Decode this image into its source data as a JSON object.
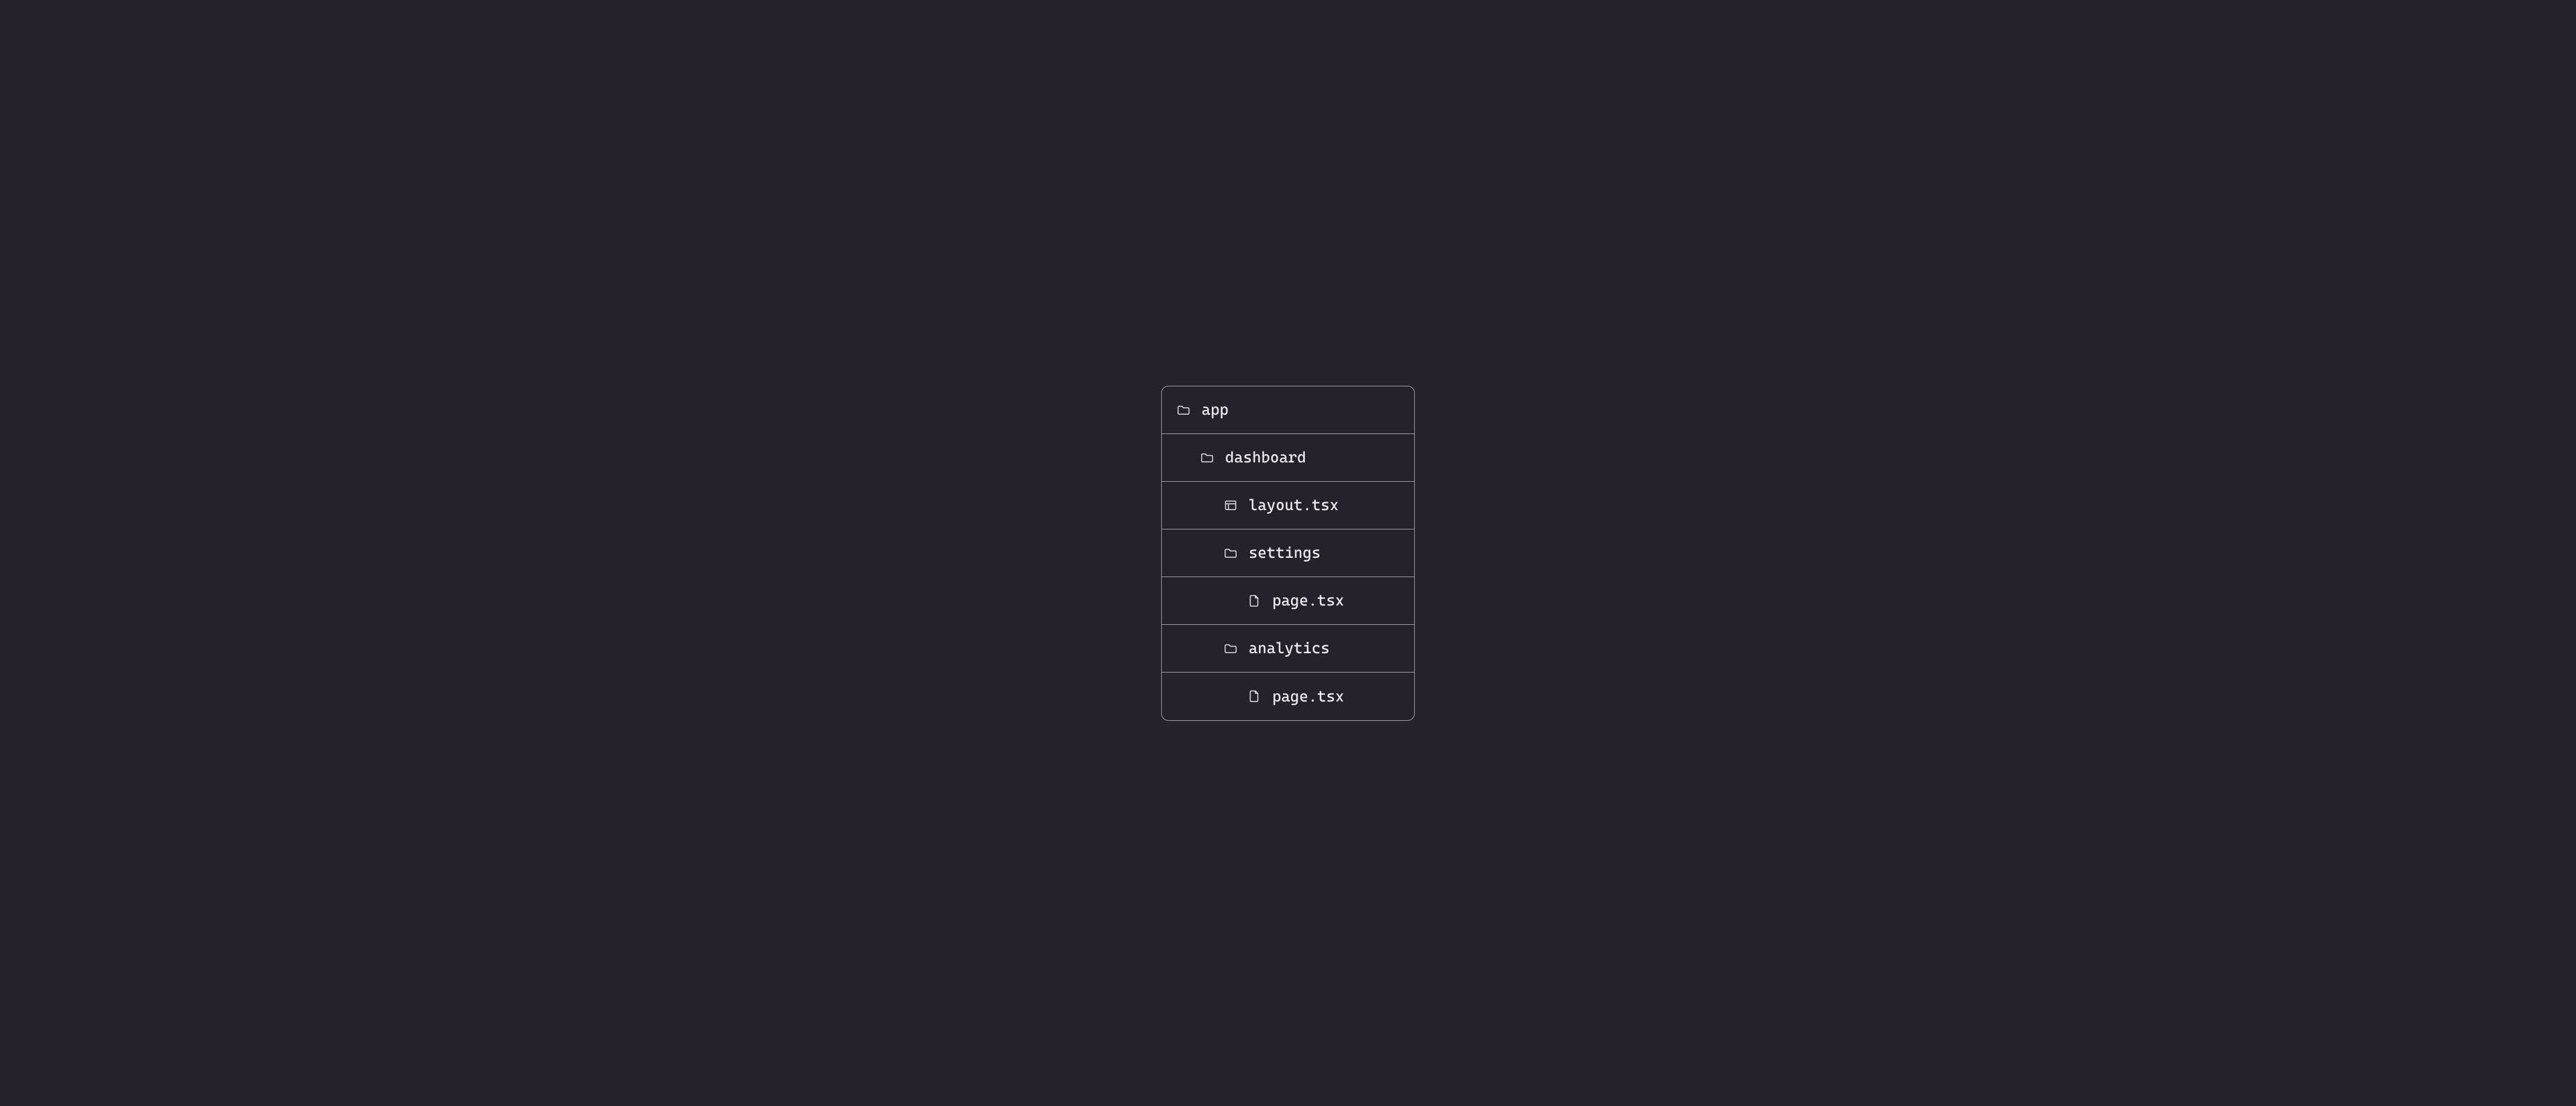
{
  "tree": {
    "items": [
      {
        "icon": "folder",
        "label": "app",
        "depth": 0
      },
      {
        "icon": "folder",
        "label": "dashboard",
        "depth": 1
      },
      {
        "icon": "layout",
        "label": "layout.tsx",
        "depth": 2
      },
      {
        "icon": "folder",
        "label": "settings",
        "depth": 2
      },
      {
        "icon": "file",
        "label": "page.tsx",
        "depth": 3
      },
      {
        "icon": "folder",
        "label": "analytics",
        "depth": 2
      },
      {
        "icon": "file",
        "label": "page.tsx",
        "depth": 3
      }
    ]
  }
}
